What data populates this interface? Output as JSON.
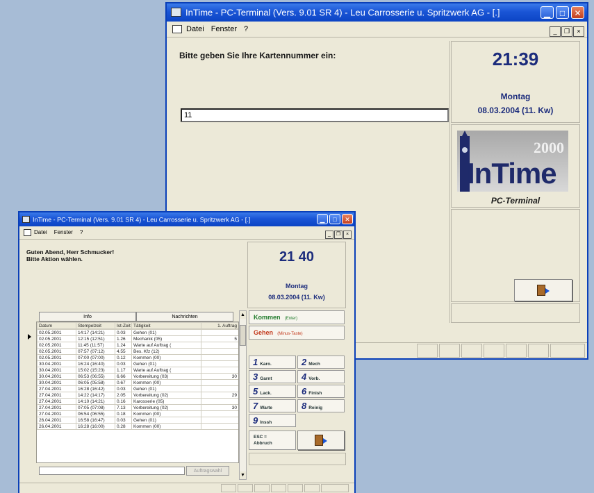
{
  "back_window": {
    "title": "InTime - PC-Terminal (Vers. 9.01 SR 4) - Leu Carrosserie u. Spritzwerk AG - [.]",
    "menu": [
      "Datei",
      "Fenster",
      "?"
    ],
    "prompt": "Bitte geben Sie Ihre Kartennummer ein:",
    "card_input_value": "11",
    "time": "21:39",
    "weekday": "Montag",
    "date": "08.03.2004 (11. Kw)",
    "logo_year": "2000",
    "logo_text": "InTime",
    "terminal_label": "PC-Terminal"
  },
  "front_window": {
    "title": "InTime - PC-Terminal (Vers. 9.01 SR 4) - Leu Carrosserie u. Spritzwerk AG - [.]",
    "menu": [
      "Datei",
      "Fenster",
      "?"
    ],
    "greeting_line1": "Guten Abend, Herr Schmucker!",
    "greeting_line2": "Bitte Aktion wählen.",
    "time": "21 40",
    "weekday": "Montag",
    "date": "08.03.2004 (11. Kw)",
    "tab_info": "Info",
    "tab_messages": "Nachrichten",
    "columns": [
      "Datum",
      "Stempelzeit",
      "Ist-Zeit",
      "Tätigkeit",
      "1. Auftrag"
    ],
    "rows": [
      [
        "02.05.2001",
        "14:17 (14:21)",
        "0.03",
        "Gehen (01)",
        ""
      ],
      [
        "02.05.2001",
        "12:15 (12:51)",
        "1.26",
        "Mechanik (05)",
        "5"
      ],
      [
        "02.05.2001",
        "11:45 (11:57)",
        "1.24",
        "Warte auf Auftrag (",
        ""
      ],
      [
        "02.05.2001",
        "07:57 (07:12)",
        "4.55",
        "Bes. Kfz (12)",
        ""
      ],
      [
        "02.05.2001",
        "07:00 (07:00)",
        "0.12",
        "Kommen (00)",
        ""
      ],
      [
        "30.04.2001",
        "16:24 (16:40)",
        "0.03",
        "Gehen (01)",
        ""
      ],
      [
        "30.04.2001",
        "15:02 (15:23)",
        "1.17",
        "Warte auf Auftrag (",
        ""
      ],
      [
        "30.04.2001",
        "06:53 (06:55)",
        "6.66",
        "Vorbereitung (03)",
        "30"
      ],
      [
        "30.04.2001",
        "06:05 (05:58)",
        "0.67",
        "Kommen (00)",
        ""
      ],
      [
        "27.04.2001",
        "16:28 (16:42)",
        "0.03",
        "Gehen (01)",
        ""
      ],
      [
        "27.04.2001",
        "14:22 (14:17)",
        "2.05",
        "Vorbereitung (02)",
        "29"
      ],
      [
        "27.04.2001",
        "14:10 (14:21)",
        "0.16",
        "Karosserie (05)",
        ""
      ],
      [
        "27.04.2001",
        "07:05 (07:08)",
        "7.13",
        "Vorbereitung (02)",
        "30"
      ],
      [
        "27.04.2001",
        "06:54 (06:55)",
        "0.18",
        "Kommen (00)",
        ""
      ],
      [
        "26.04.2001",
        "16:58 (16:47)",
        "0.03",
        "Gehen (01)",
        ""
      ],
      [
        "26.04.2001",
        "16:28 (16:00)",
        "0.28",
        "Kommen (00)",
        ""
      ]
    ],
    "action_kommen": "Kommen",
    "action_kommen_hint": "(Enter)",
    "action_gehen": "Gehen",
    "action_gehen_hint": "(Minus-Taste)",
    "keys": [
      {
        "num": "1",
        "label": "Karo."
      },
      {
        "num": "2",
        "label": "Mech"
      },
      {
        "num": "3",
        "label": "Garnt"
      },
      {
        "num": "4",
        "label": "Vorb."
      },
      {
        "num": "5",
        "label": "Lack."
      },
      {
        "num": "6",
        "label": "Finish"
      },
      {
        "num": "7",
        "label": "Warte"
      },
      {
        "num": "8",
        "label": "Reinig"
      },
      {
        "num": "9",
        "label": "Inssh"
      }
    ],
    "esc_line1": "ESC =",
    "esc_line2": "Abbruch",
    "assign_button": "Auftragswahl"
  }
}
